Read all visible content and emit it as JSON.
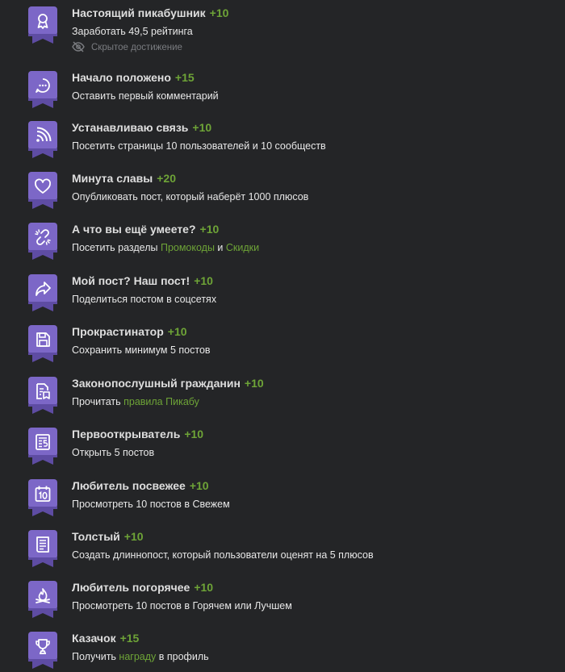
{
  "colors": {
    "background": "#242527",
    "badge": "#7c67c7",
    "badge_dark": "#5e4ca3",
    "points": "#6ea437",
    "title": "#dedede",
    "text": "#e8e8e8",
    "muted": "#7a7c80"
  },
  "hidden_label": "Скрытое достижение",
  "achievements": [
    {
      "icon": "medal-icon",
      "title": "Настоящий пикабушник",
      "points": "+10",
      "desc": "Заработать 49,5 рейтинга",
      "hidden": true
    },
    {
      "icon": "chat-bubble-icon",
      "title": "Начало положено",
      "points": "+15",
      "desc": "Оставить первый комментарий"
    },
    {
      "icon": "rss-icon",
      "title": "Устанавливаю связь",
      "points": "+10",
      "desc": "Посетить страницы 10 пользователей и 10 сообществ"
    },
    {
      "icon": "heart-icon",
      "title": "Минута славы",
      "points": "+20",
      "desc": "Опубликовать пост, который наберёт 1000 плюсов"
    },
    {
      "icon": "link-icon",
      "title": "А что вы ещё умеете?",
      "points": "+10",
      "desc_parts": [
        {
          "text": "Посетить разделы "
        },
        {
          "text": "Промокоды",
          "link": true
        },
        {
          "text": " и "
        },
        {
          "text": "Скидки",
          "link": true
        }
      ]
    },
    {
      "icon": "share-arrow-icon",
      "title": "Мой пост? Наш пост!",
      "points": "+10",
      "desc": "Поделиться постом в соцсетях"
    },
    {
      "icon": "floppy-disk-icon",
      "title": "Прокрастинатор",
      "points": "+10",
      "desc": "Сохранить минимум 5 постов"
    },
    {
      "icon": "document-book-icon",
      "title": "Законопослушный гражданин",
      "points": "+10",
      "desc_parts": [
        {
          "text": "Прочитать "
        },
        {
          "text": "правила Пикабу",
          "link": true
        }
      ]
    },
    {
      "icon": "document-5-icon",
      "title": "Первооткрыватель",
      "points": "+10",
      "desc": "Открыть 5 постов"
    },
    {
      "icon": "calendar-10-icon",
      "title": "Любитель посвежее",
      "points": "+10",
      "desc": "Просмотреть 10 постов в Свежем"
    },
    {
      "icon": "long-document-icon",
      "title": "Толстый",
      "points": "+10",
      "desc": "Создать длиннопост, который пользователи оценят на 5 плюсов"
    },
    {
      "icon": "campfire-icon",
      "title": "Любитель погорячее",
      "points": "+10",
      "desc": "Просмотреть 10 постов в Горячем или Лучшем"
    },
    {
      "icon": "trophy-icon",
      "title": "Казачок",
      "points": "+15",
      "desc_parts": [
        {
          "text": "Получить "
        },
        {
          "text": "награду",
          "link": true
        },
        {
          "text": " в профиль"
        }
      ]
    }
  ]
}
